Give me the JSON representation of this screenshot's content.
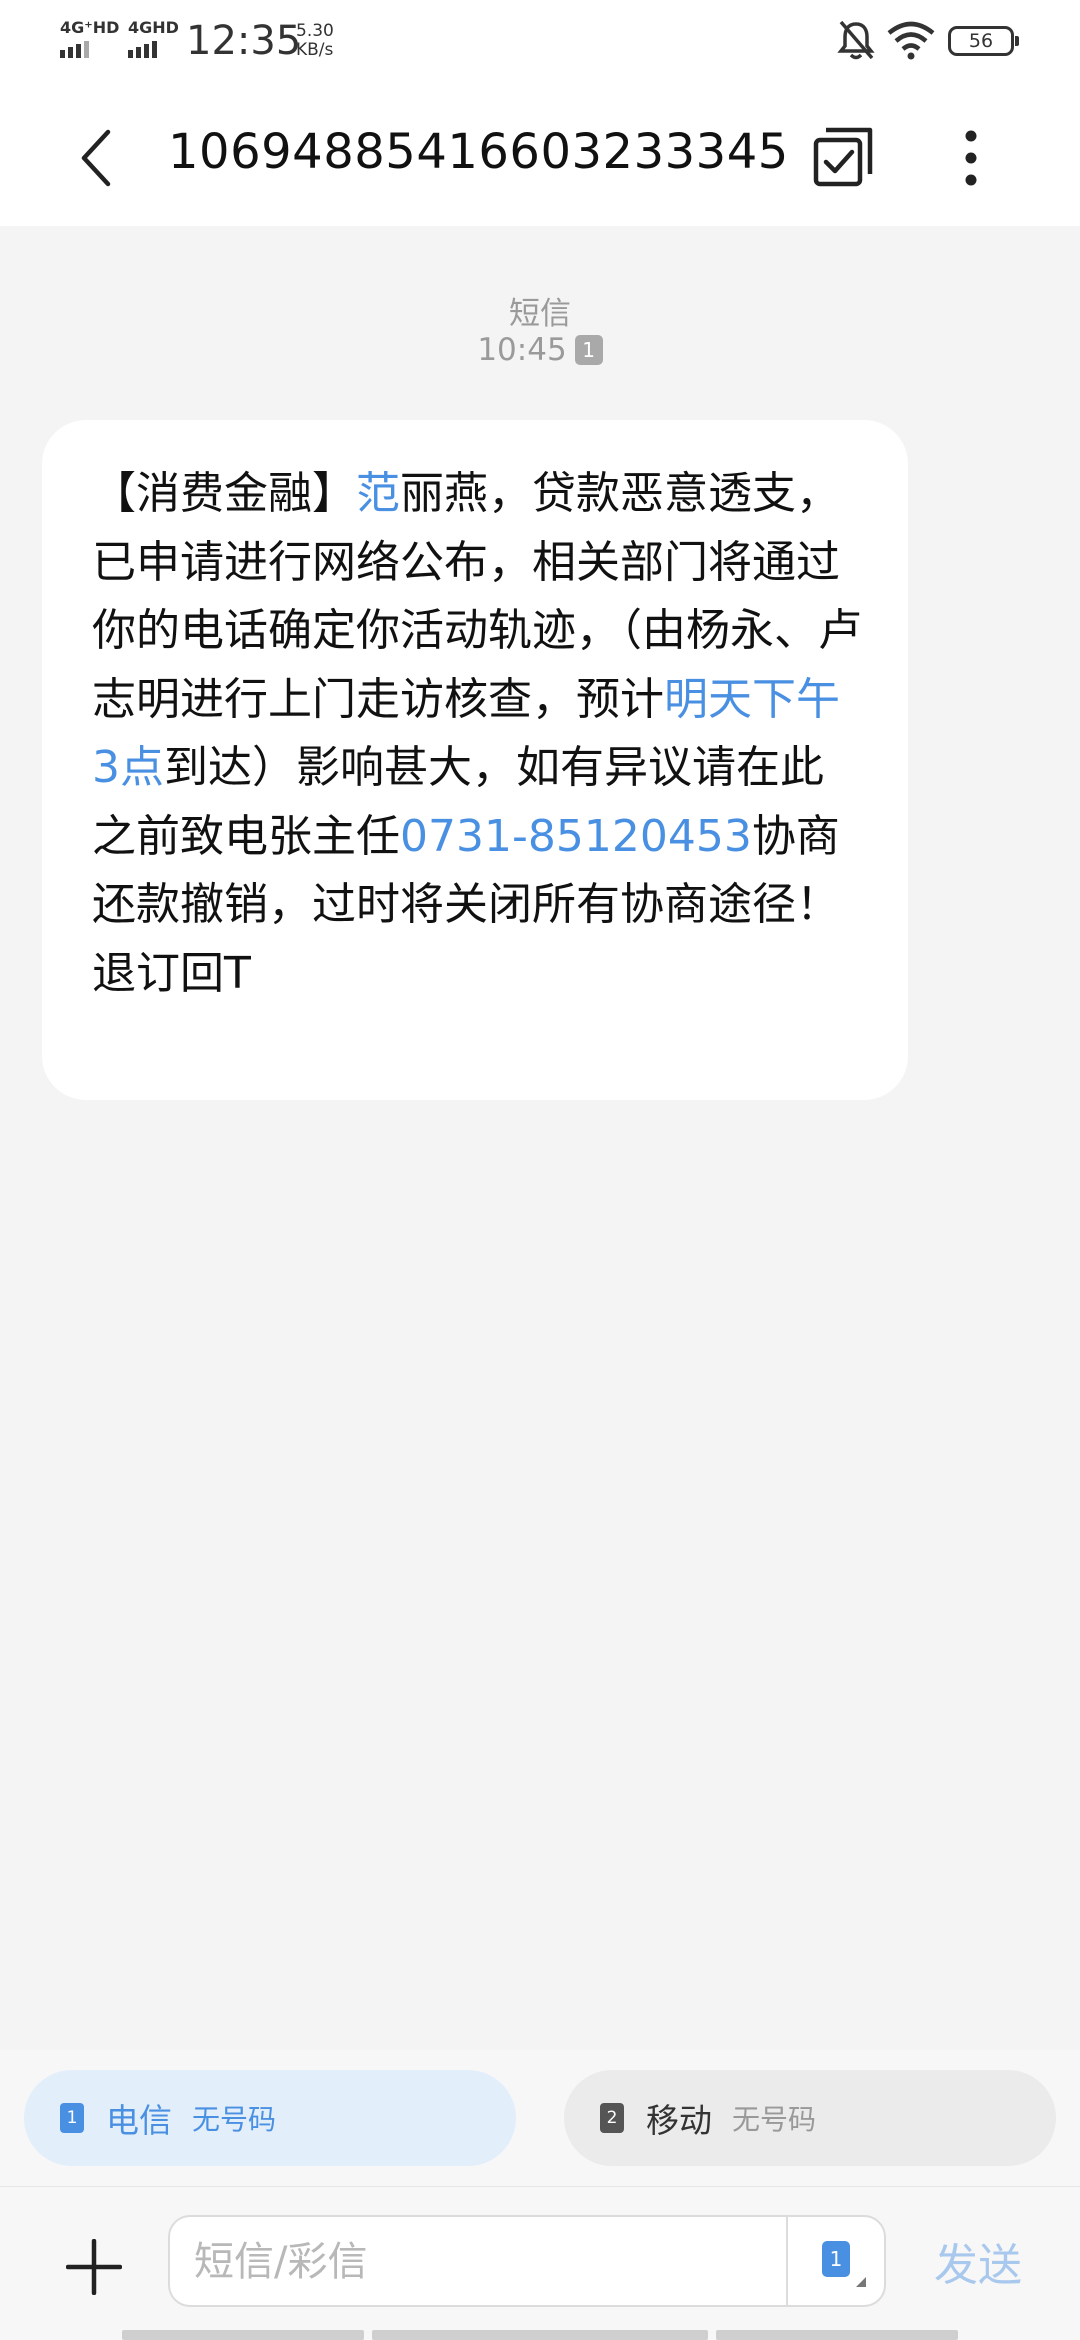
{
  "status_bar": {
    "signal1_label": "4G⁺HD",
    "signal2_label": "4GHD",
    "time": "12:35",
    "speed_value": "5.30",
    "speed_unit": "KB/s",
    "battery": "56",
    "icons": [
      "bell-muted-icon",
      "wifi-icon",
      "battery-icon"
    ]
  },
  "header": {
    "title": "10694885416603233345",
    "back_icon": "chevron-left-icon",
    "select_icon": "multi-select-check-icon",
    "more_icon": "more-vertical-icon"
  },
  "conversation": {
    "type_label": "短信",
    "time": "10:45",
    "sim_badge": "1",
    "message_segments": [
      {
        "text": "【消费金融】",
        "link": false
      },
      {
        "text": "范",
        "link": true
      },
      {
        "text": "丽燕，贷款恶意透支，已申请进行网络公布，相关部门将通过你的电话确定你活动轨迹，（由杨永、卢志明进行上门走访核查，预计",
        "link": false
      },
      {
        "text": "明天下午3点",
        "link": true
      },
      {
        "text": "到达）影响甚大，如有异议请在此之前致电张主任",
        "link": false
      },
      {
        "text": "0731-85120453",
        "link": true
      },
      {
        "text": "协商还款撤销，过时将关闭所有协商途径！退订回T",
        "link": false
      }
    ]
  },
  "sim_selector": {
    "sim1": {
      "index": "1",
      "carrier": "电信",
      "number": "无号码"
    },
    "sim2": {
      "index": "2",
      "carrier": "移动",
      "number": "无号码"
    }
  },
  "composer": {
    "placeholder": "短信/彩信",
    "sim_chip": "1",
    "send_label": "发送",
    "add_icon": "plus-icon"
  },
  "colors": {
    "accent": "#4a90e2",
    "background": "#f4f4f5",
    "bubble": "#ffffff",
    "send_disabled": "#a8c8ee"
  }
}
